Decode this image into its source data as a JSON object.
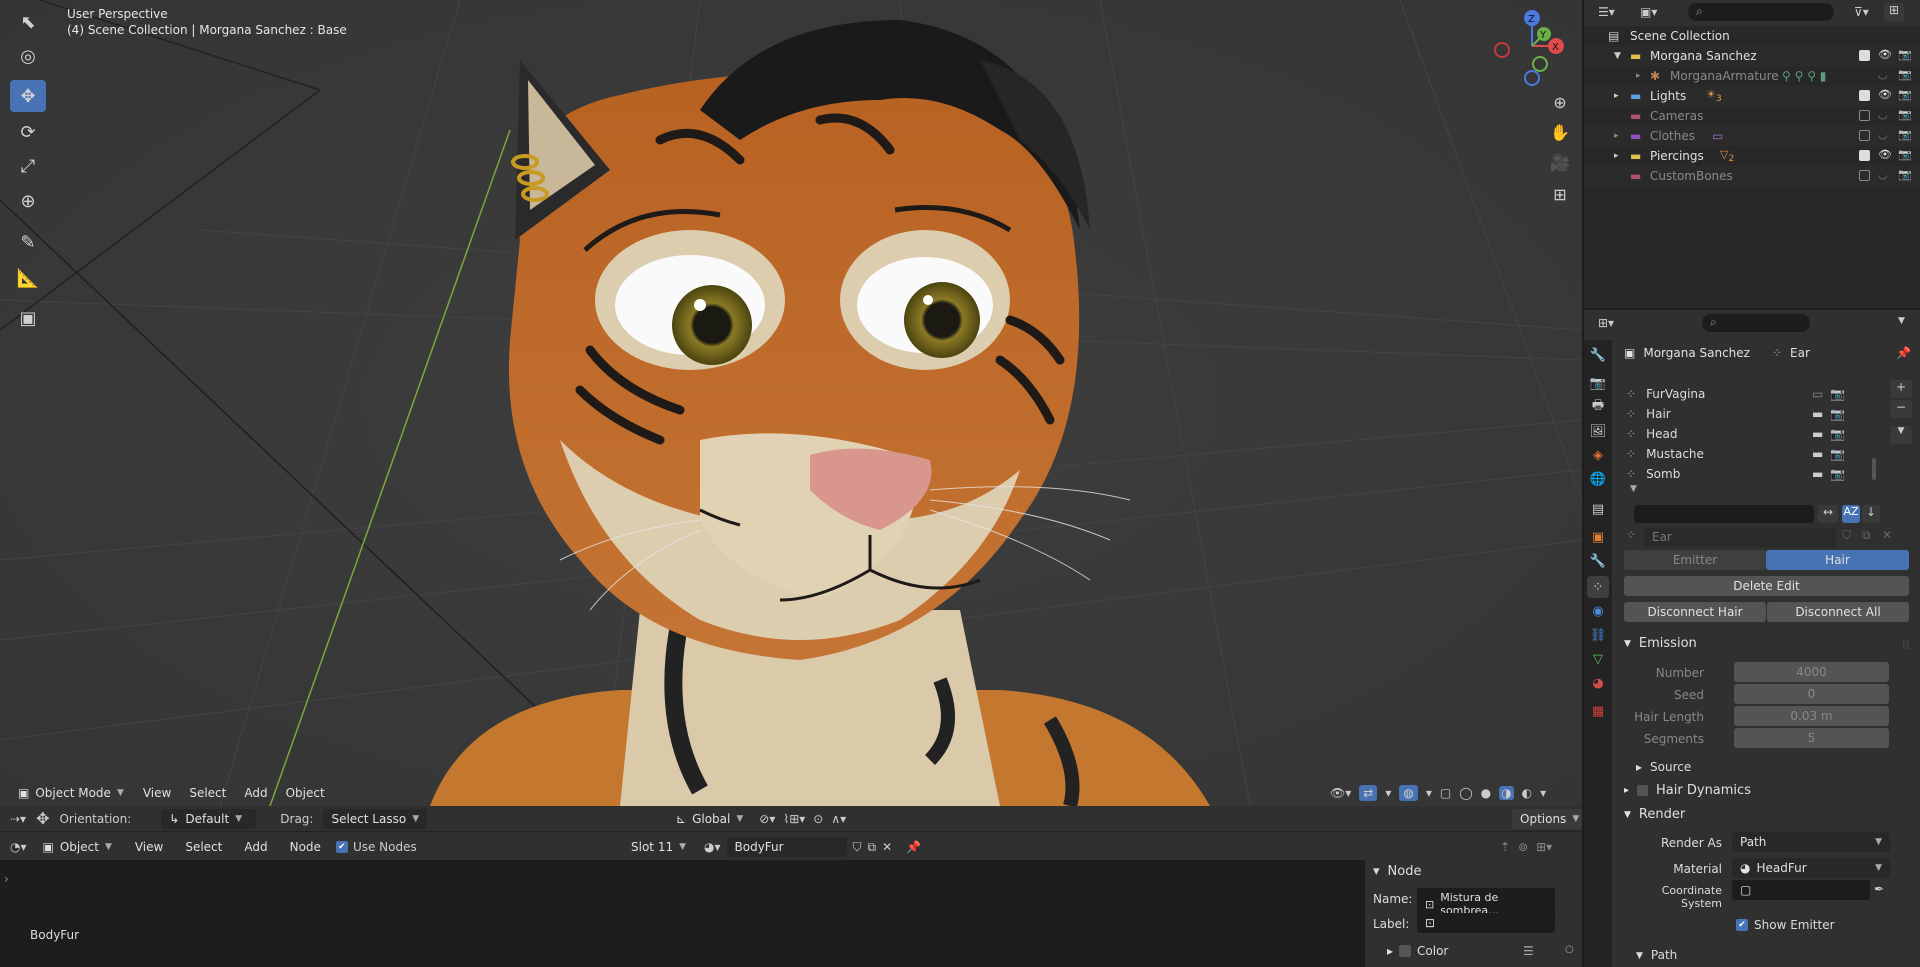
{
  "viewport": {
    "title_line1": "User Perspective",
    "title_line2": "(4) Scene Collection | Morgana Sanchez : Base",
    "gizmo": {
      "z": "Z",
      "y": "Y",
      "x": "X"
    },
    "header": {
      "mode": "Object Mode",
      "menus": [
        "View",
        "Select",
        "Add",
        "Object"
      ]
    },
    "tools": [
      "select-box-icon",
      "cursor-icon",
      "move-icon",
      "rotate-icon",
      "scale-icon",
      "transform-icon",
      "annotate-icon",
      "measure-icon",
      "add-cube-icon"
    ]
  },
  "tool_header": {
    "orientation_label": "Orientation:",
    "orientation_value": "Default",
    "drag_label": "Drag:",
    "drag_value": "Select Lasso",
    "transform_orientation": "Global",
    "options": "Options"
  },
  "node_header": {
    "editor_mode": "Object",
    "menus": [
      "View",
      "Select",
      "Add",
      "Node"
    ],
    "use_nodes": "Use Nodes",
    "slot": "Slot 11",
    "material": "BodyFur"
  },
  "node_editor": {
    "material_label": "BodyFur",
    "panel": {
      "title": "Node",
      "name_label": "Name:",
      "name_value": "Mistura de sombrea...",
      "label_label": "Label:",
      "label_value": "",
      "color_label": "Color"
    }
  },
  "outliner": {
    "items": [
      {
        "label": "Scene Collection",
        "enabled": true
      },
      {
        "label": "Morgana Sanchez",
        "enabled": true
      },
      {
        "label": "MorganaArmature",
        "enabled": false
      },
      {
        "label": "Lights",
        "enabled": true,
        "badge": "3"
      },
      {
        "label": "Cameras",
        "enabled": false
      },
      {
        "label": "Clothes",
        "enabled": false
      },
      {
        "label": "Piercings",
        "enabled": true,
        "badge": "2"
      },
      {
        "label": "CustomBones",
        "enabled": false
      }
    ]
  },
  "properties": {
    "breadcrumb_object": "Morgana Sanchez",
    "breadcrumb_data": "Ear",
    "particle_systems": [
      "FurVagina",
      "Hair",
      "Head",
      "Mustache",
      "Somb"
    ],
    "active_system": "Ear",
    "type_emitter": "Emitter",
    "type_hair": "Hair",
    "delete_edit": "Delete Edit",
    "disconnect_hair": "Disconnect Hair",
    "disconnect_all": "Disconnect All",
    "emission": {
      "title": "Emission",
      "number_label": "Number",
      "number_value": "4000",
      "seed_label": "Seed",
      "seed_value": "0",
      "hair_length_label": "Hair Length",
      "hair_length_value": "0.03 m",
      "segments_label": "Segments",
      "segments_value": "5"
    },
    "source": "Source",
    "hair_dynamics": "Hair Dynamics",
    "render": {
      "title": "Render",
      "render_as_label": "Render As",
      "render_as_value": "Path",
      "material_label": "Material",
      "material_value": "HeadFur",
      "coord_label": "Coordinate System",
      "show_emitter": "Show Emitter"
    },
    "path": "Path"
  },
  "colors": {
    "accent": "#4772b3",
    "viewport_bg": "#393939",
    "fur_orange": "#c4672a",
    "fur_cream": "#d9c8a8"
  }
}
